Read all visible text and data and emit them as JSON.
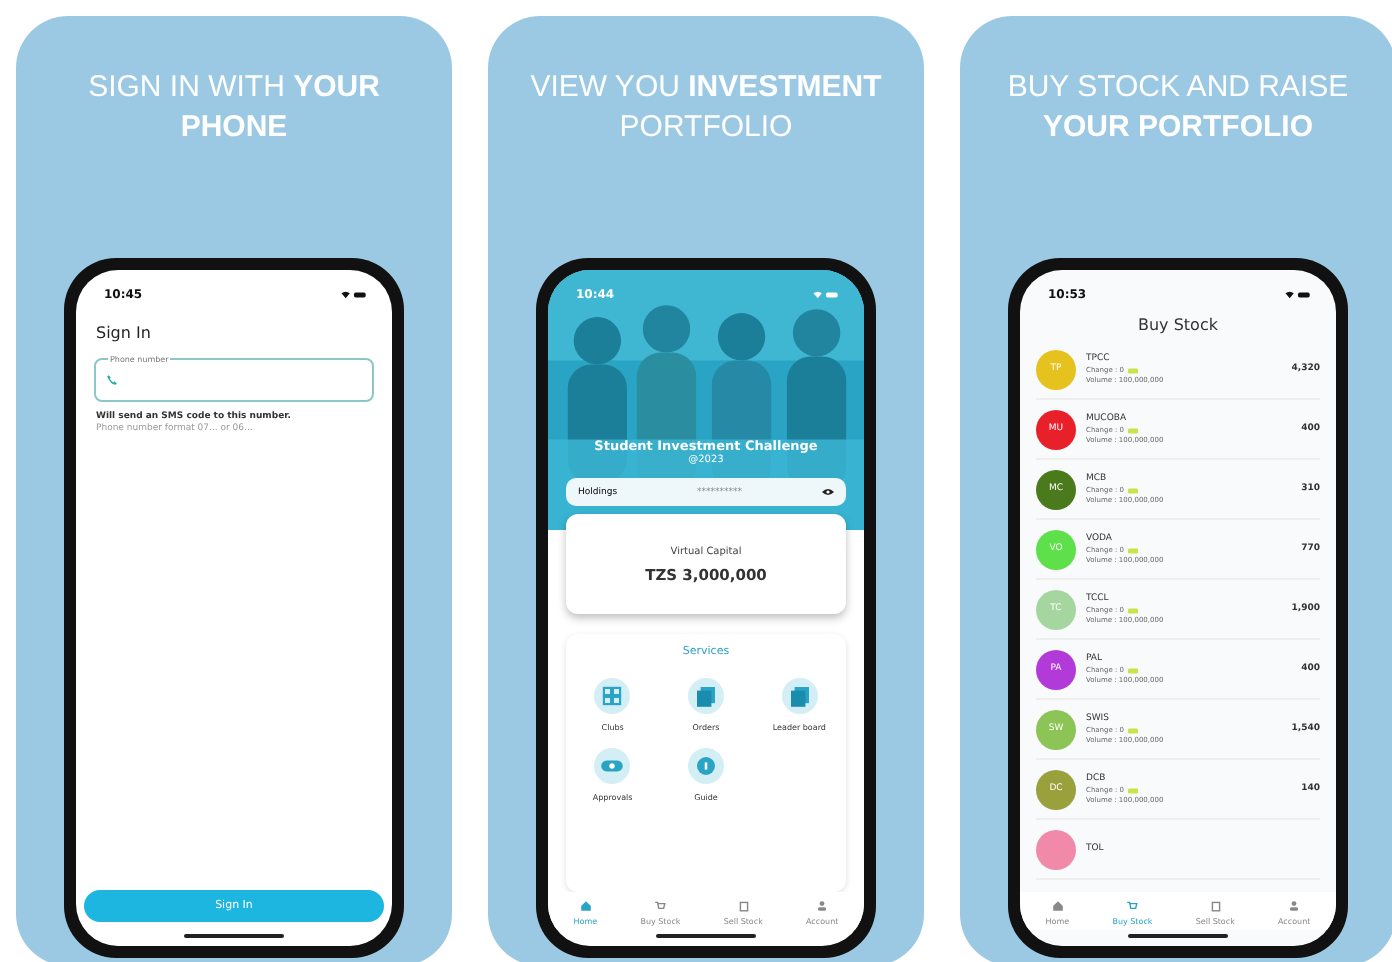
{
  "panels": [
    {
      "kind": "signin",
      "headline": "SIGN IN WITH **YOUR PHONE**",
      "time": "10:45",
      "title": "Sign In",
      "field_label": "Phone number",
      "hint": "Will send an SMS code to this number.",
      "format_hint": "Phone number format 07... or 06...",
      "button": "Sign In"
    },
    {
      "kind": "home",
      "headline": "VIEW YOU **INVESTMENT** PORTFOLIO",
      "time": "10:44",
      "banner_title": "Student Investment Challenge",
      "banner_subtitle": "@2023",
      "holdings_label": "Holdings",
      "holdings_value": "**********",
      "capital_label": "Virtual Capital",
      "capital_value": "TZS 3,000,000",
      "services_title": "Services",
      "services": [
        {
          "label": "Clubs"
        },
        {
          "label": "Orders"
        },
        {
          "label": "Leader board"
        },
        {
          "label": "Approvals"
        },
        {
          "label": "Guide"
        }
      ],
      "nav": [
        {
          "label": "Home",
          "selected": true
        },
        {
          "label": "Buy Stock",
          "selected": false
        },
        {
          "label": "Sell Stock",
          "selected": false
        },
        {
          "label": "Account",
          "selected": false
        }
      ]
    },
    {
      "kind": "stocks",
      "headline": "BUY STOCK AND RAISE **YOUR PORTFOLIO**",
      "time": "10:53",
      "title": "Buy Stock",
      "stocks": [
        {
          "initials": "TP",
          "name": "TPCC",
          "change": "Change : 0",
          "volume": "Volume : 100,000,000",
          "price": "4,320",
          "color": "#e6c21e"
        },
        {
          "initials": "MU",
          "name": "MUCOBA",
          "change": "Change : 0",
          "volume": "Volume : 100,000,000",
          "price": "400",
          "color": "#e8202a"
        },
        {
          "initials": "MC",
          "name": "MCB",
          "change": "Change : 0",
          "volume": "Volume : 100,000,000",
          "price": "310",
          "color": "#4a7a1c"
        },
        {
          "initials": "VO",
          "name": "VODA",
          "change": "Change : 0",
          "volume": "Volume : 100,000,000",
          "price": "770",
          "color": "#5ee04a"
        },
        {
          "initials": "TC",
          "name": "TCCL",
          "change": "Change : 0",
          "volume": "Volume : 100,000,000",
          "price": "1,900",
          "color": "#a5d6a0"
        },
        {
          "initials": "PA",
          "name": "PAL",
          "change": "Change : 0",
          "volume": "Volume : 100,000,000",
          "price": "400",
          "color": "#b23ad8"
        },
        {
          "initials": "SW",
          "name": "SWIS",
          "change": "Change : 0",
          "volume": "Volume : 100,000,000",
          "price": "1,540",
          "color": "#8cc456"
        },
        {
          "initials": "DC",
          "name": "DCB",
          "change": "Change : 0",
          "volume": "Volume : 100,000,000",
          "price": "140",
          "color": "#9aa03c"
        },
        {
          "name": "TOL",
          "color": "#f08aa8"
        }
      ],
      "nav": [
        {
          "label": "Home",
          "selected": false
        },
        {
          "label": "Buy Stock",
          "selected": true
        },
        {
          "label": "Sell Stock",
          "selected": false
        },
        {
          "label": "Account",
          "selected": false
        }
      ]
    }
  ]
}
